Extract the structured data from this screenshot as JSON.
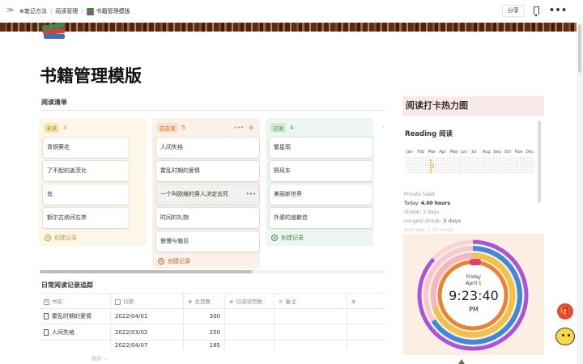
{
  "topbar": {
    "breadcrumb": [
      "⊕笔记方法",
      "阅读管理",
      "书籍管理模版"
    ],
    "share_label": "分享",
    "more_label": "•••"
  },
  "page": {
    "title": "书籍管理模版",
    "reading_list_label": "阅读清单",
    "daily_tracking_label": "日常阅读记录追踪"
  },
  "board": {
    "columns": [
      {
        "tag": "未读",
        "count": "4",
        "tag_bg": "#fae5b8",
        "tag_color": "#b07b18",
        "col_bg": "#fdf7e8",
        "count_color": "#c59a3e",
        "cards": [
          "青铜葵花",
          "了不起的盖茨比",
          "岛",
          "额尔古纳河右岸"
        ],
        "new_label": "创建记录",
        "new_color": "#c59a3e"
      },
      {
        "tag": "正在读",
        "count": "5",
        "tag_bg": "#fbdfc9",
        "tag_color": "#c4642a",
        "col_bg": "#fcf1e9",
        "count_color": "#c4642a",
        "cards": [
          "人间失格",
          "霍乱时期的爱情",
          "一个叫欧维的男人决定去死",
          "时间的礼物",
          "傲慢与偏见"
        ],
        "new_label": "创建记录",
        "new_color": "#c4642a"
      },
      {
        "tag": "已读",
        "count": "4",
        "tag_bg": "#d3ebd9",
        "tag_color": "#3b8d55",
        "col_bg": "#eef6f0",
        "count_color": "#3b8d55",
        "cards": [
          "繁星雨",
          "野风车",
          "美丽新世界",
          "外婆的道歉信"
        ],
        "new_label": "创建记录",
        "new_color": "#3b8d55"
      }
    ]
  },
  "table": {
    "headers": [
      "书名",
      "日期",
      "总页数",
      "已阅读页数",
      "备注"
    ],
    "rows": [
      {
        "name": "霍乱时期的爱情",
        "date": "2022/04/01",
        "pages": "300"
      },
      {
        "name": "人间失格",
        "date": "2022/03/02",
        "pages": "250"
      },
      {
        "name": "",
        "date": "2022/04/07",
        "pages": "185"
      }
    ],
    "summary_label": "统计 ⌄"
  },
  "heatmap": {
    "panel_title": "阅读打卡热力图",
    "heading": "Reading 阅读",
    "months": [
      "Jan",
      "Feb",
      "Mar",
      "Apr",
      "May",
      "Jun",
      "Jul",
      "Aug",
      "Sep",
      "Oct",
      "Nov",
      "Dec"
    ],
    "stats": [
      {
        "label": "Private habit",
        "value": ""
      },
      {
        "label": "Today: ",
        "value": "4.00 hours"
      },
      {
        "label": "Streak: ",
        "value": "2 days"
      },
      {
        "label": "Longest streak: ",
        "value": "5 days"
      },
      {
        "label": "Average: ",
        "value": "2.00 hours"
      }
    ],
    "active_color": "#f0b43c"
  },
  "clock": {
    "day": "Friday",
    "date": "April 1",
    "time": "9:23:40",
    "ampm": "PM"
  }
}
